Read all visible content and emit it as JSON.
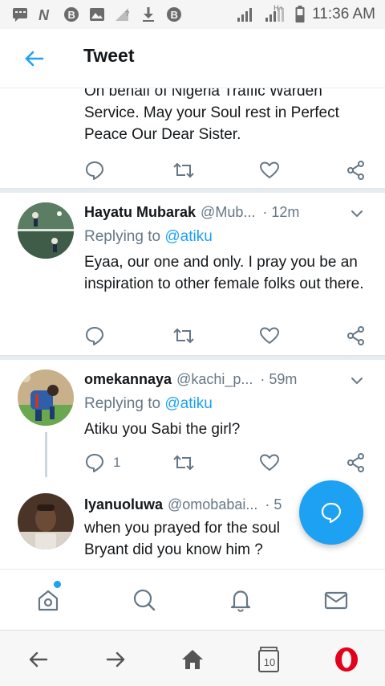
{
  "status_bar": {
    "time": "11:36 AM",
    "network_label": "H+"
  },
  "header": {
    "title": "Tweet"
  },
  "top_tweet": {
    "text": "On behalf of Nigeria Traffic Warden Service. May your Soul rest in Perfect Peace Our Dear Sister."
  },
  "tweets": [
    {
      "name": "Hayatu Mubarak",
      "handle": "@Mub...",
      "time": "· 12m",
      "replying_prefix": "Replying to ",
      "replying_to": "@atiku",
      "text": "Eyaa, our one and only. I pray you be an inspiration to other female folks out there.",
      "reply_count": "",
      "avatar_colors": [
        "#3d5a4a",
        "#6f8a6a"
      ]
    },
    {
      "name": "omekannaya",
      "handle": "@kachi_p...",
      "time": "· 59m",
      "replying_prefix": "Replying to ",
      "replying_to": "@atiku",
      "text": "Atiku you Sabi the girl?",
      "reply_count": "1",
      "avatar_colors": [
        "#2f6fa8",
        "#6aa84f"
      ]
    },
    {
      "name": "Iyanuoluwa",
      "handle": "@omobabai...",
      "time": "· 5",
      "text": "when you prayed for the soul Bryant did you know him ?",
      "avatar_colors": [
        "#5a3a2a",
        "#c9c2b8"
      ]
    }
  ],
  "icons": {
    "back": "arrow-left-icon",
    "reply": "speech-bubble-icon",
    "retweet": "retweet-icon",
    "like": "heart-icon",
    "share": "share-icon",
    "compose": "compose-reply-icon"
  },
  "tab_bar": {
    "items": [
      "home",
      "search",
      "notifications",
      "messages"
    ]
  },
  "browser_nav": {
    "tabs_count": "10"
  },
  "colors": {
    "accent": "#1da1f2",
    "secondary_text": "#657786",
    "opera_red": "#e3001b"
  }
}
